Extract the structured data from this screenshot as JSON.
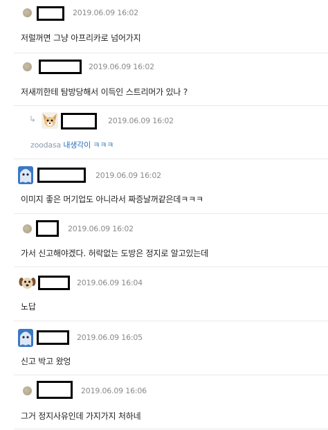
{
  "comments": [
    {
      "time": "2019.06.09 16:02",
      "text": "저럴꺼면 그냥 아프리카로 넘어가지"
    },
    {
      "time": "2019.06.09 16:02",
      "text": "저새끼한테 탐방당해서 이득인 스트리머가 있나 ?"
    },
    {
      "time": "2019.06.09 16:02",
      "reply_to": "zoodasa",
      "text": "내생각이 ㅋㅋㅋ",
      "arrow": "↳"
    },
    {
      "time": "2019.06.09 16:02",
      "text": "이미지 좋은 머기업도 아니라서 짜증날꺼같은데ㅋㅋㅋ"
    },
    {
      "time": "2019.06.09 16:02",
      "text": "가서 신고해야겠다. 허락없는 도방은 정지로 알고있는데"
    },
    {
      "time": "2019.06.09 16:04",
      "text": "노답"
    },
    {
      "time": "2019.06.09 16:05",
      "text": "신고 박고 왔엉"
    },
    {
      "time": "2019.06.09 16:06",
      "text": "그거 정지사유인데 가지가지 처하네"
    }
  ]
}
